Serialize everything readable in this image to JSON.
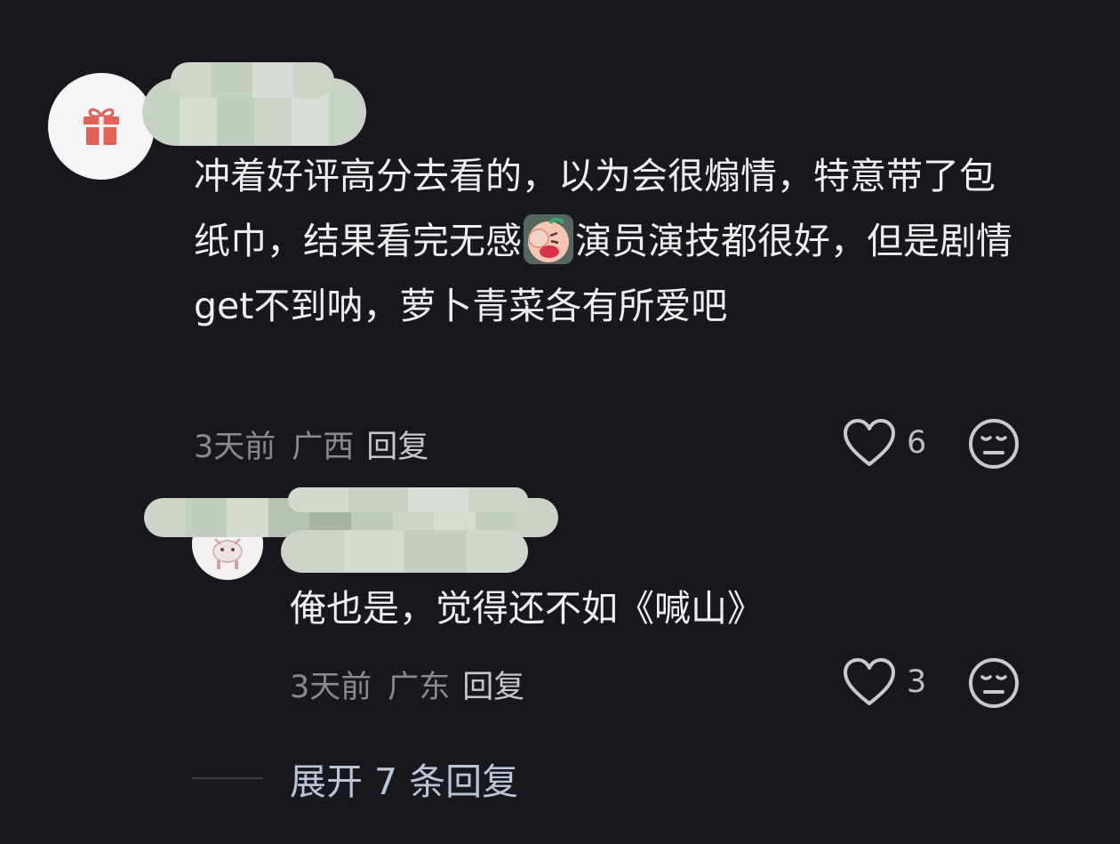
{
  "comment": {
    "text_part1": "冲着好评高分去看的，以为会很煽情，特意带了包纸巾，结果看完无感",
    "emoji": "facepalm-emoji",
    "text_part2": "演员演技都很好，但是剧情get不到呐，萝卜青菜各有所爱吧",
    "time": "3天前",
    "location": "广西",
    "reply_label": "回复",
    "like_count": "6",
    "avatar_icon": "gift-icon"
  },
  "reply": {
    "text": "俺也是，觉得还不如《喊山》",
    "time": "3天前",
    "location": "广东",
    "reply_label": "回复",
    "like_count": "3"
  },
  "expand": {
    "label": "展开 7 条回复"
  },
  "colors": {
    "background": "#17171d",
    "text": "#efefef",
    "meta": "#8a8a8e",
    "expand": "#bcc5d6"
  }
}
